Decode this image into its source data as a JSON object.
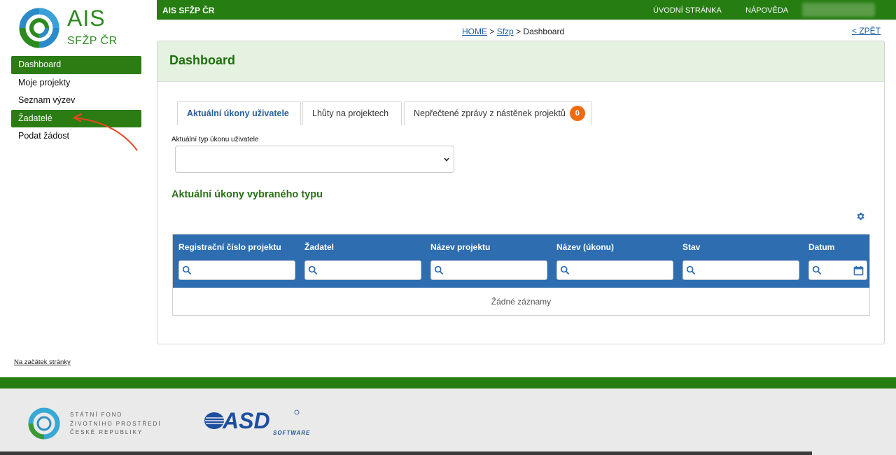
{
  "logo": {
    "title": "AIS",
    "subtitle": "SFŽP ČR"
  },
  "sidebar": {
    "items": [
      {
        "label": "Dashboard",
        "active": true
      },
      {
        "label": "Moje projekty",
        "active": false
      },
      {
        "label": "Seznam výzev",
        "active": false
      },
      {
        "label": "Žadatelé",
        "active": true
      },
      {
        "label": "Podat žádost",
        "active": false
      }
    ],
    "to_top": "Na začátek stránky"
  },
  "topbar": {
    "brand": "AIS SFŽP ČR",
    "nav": [
      "ÚVODNÍ STRÁNKA",
      "NÁPOVĚDA"
    ]
  },
  "breadcrumb": {
    "home": "HOME",
    "sep1": ">",
    "sfzp": "Sfzp",
    "sep2": ">",
    "current": "Dashboard"
  },
  "back_link": "< ZPĚT",
  "panel": {
    "title": "Dashboard",
    "tabs": [
      {
        "label": "Aktuální úkony uživatele",
        "active": true
      },
      {
        "label": "Lhůty na projektech",
        "active": false
      },
      {
        "label": "Nepřečtené zprávy z nástěnek projektů",
        "active": false,
        "badge": "0"
      }
    ],
    "select_label": "Aktuální typ úkonu uživatele",
    "select_value": "",
    "section_title": "Aktuální úkony vybraného typu",
    "grid": {
      "columns": [
        "Registrační číslo projektu",
        "Žadatel",
        "Název projektu",
        "Název (úkonu)",
        "Stav",
        "Datum"
      ],
      "empty_text": "Žádné záznamy"
    }
  },
  "footer": {
    "sfzp_lines": [
      "STÁTNÍ FOND",
      "ŽIVOTNÍHO PROSTŘEDÍ",
      "ČESKÉ REPUBLIKY"
    ],
    "asd": "ASD",
    "asd_sub": "SOFTWARE"
  },
  "colors": {
    "primary_green": "#267d11",
    "header_blue": "#2d6db0",
    "badge_orange": "#f06a10",
    "annotation_red": "#e8461f"
  }
}
